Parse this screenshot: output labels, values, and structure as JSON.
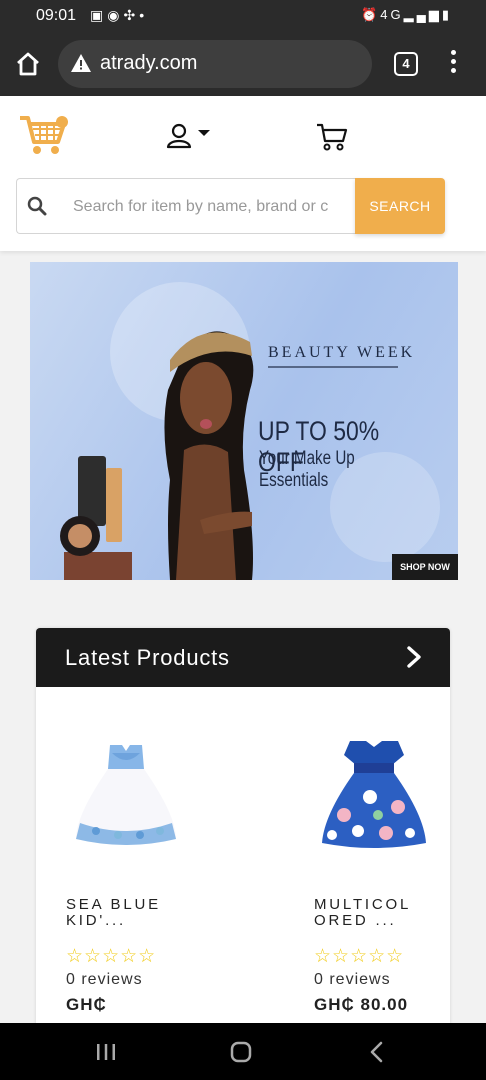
{
  "status_bar": {
    "time": "09:01",
    "left_icons": [
      "gallery-icon",
      "messenger-icon",
      "slack-icon",
      "dot-icon"
    ],
    "right_icons": [
      "alarm-icon",
      "4g-icon",
      "signal-icon",
      "battery-icon"
    ],
    "network": "4G"
  },
  "browser": {
    "url": "atrady.com",
    "tab_count": "4"
  },
  "header": {
    "logo": "cart-logo",
    "search_placeholder": "Search for item by name, brand or c",
    "search_button": "SEARCH"
  },
  "banner": {
    "heading": "BEAUTY WEEK",
    "offer": "UP TO 50% OFF",
    "subtext": "Your Make Up Essentials",
    "cta": "SHOP NOW"
  },
  "latest_products": {
    "title": "Latest Products",
    "items": [
      {
        "name_line1": "SEA BLUE",
        "name_line2": "KID'...",
        "stars": "☆☆☆☆☆",
        "reviews": "0 reviews",
        "price": "GH₵"
      },
      {
        "name_line1": "MULTICOL",
        "name_line2": "ORED ...",
        "stars": "☆☆☆☆☆",
        "reviews": "0 reviews",
        "price": "GH₵ 80.00"
      }
    ]
  },
  "colors": {
    "accent": "#f0ae4c",
    "dark": "#1b1b1b",
    "star": "#f1cc1b"
  }
}
